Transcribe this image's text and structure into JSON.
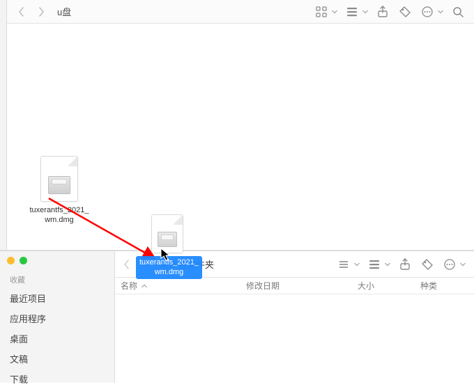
{
  "window1": {
    "title": "u盘",
    "file": {
      "name": "tuxerantfs_2021_\nwm.dmg"
    }
  },
  "drag": {
    "label": "tuxerantfs_2021_\nwm.dmg"
  },
  "window2": {
    "title": "未命名文件夹",
    "sidebar": {
      "section": "收藏",
      "items": [
        "最近项目",
        "应用程序",
        "桌面",
        "文稿",
        "下载"
      ]
    },
    "columns": {
      "name": "名称",
      "date": "修改日期",
      "size": "大小",
      "kind": "种类"
    }
  },
  "icons": {
    "back": "back-chevron",
    "forward": "forward-chevron",
    "icon_view": "icon-grid",
    "group": "group-stack",
    "share": "share-box",
    "tags": "tag",
    "more": "ellipsis-circle",
    "search": "magnifier",
    "list_view": "list-lines"
  }
}
